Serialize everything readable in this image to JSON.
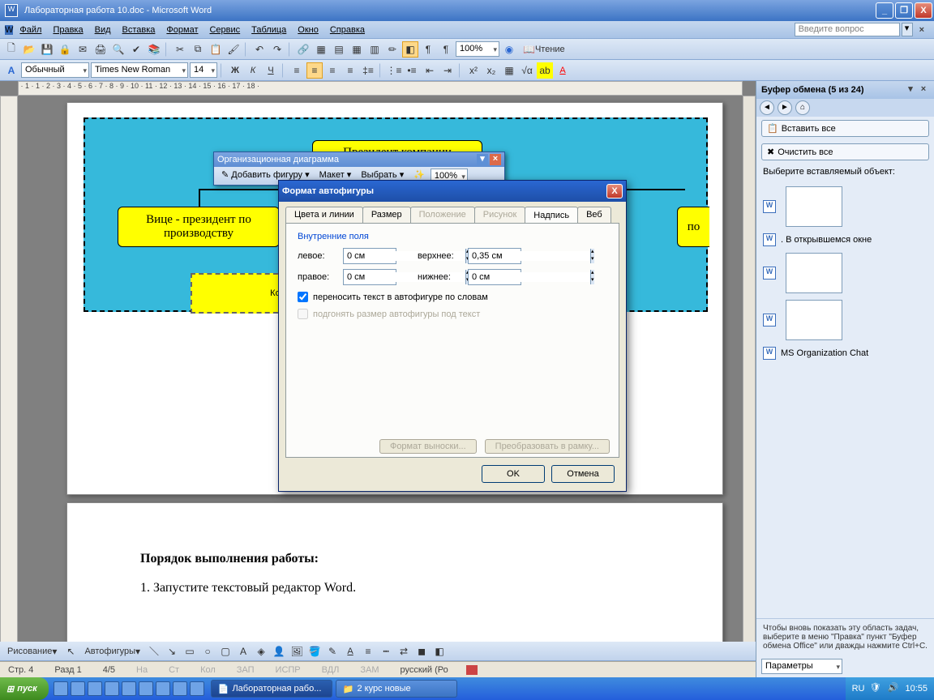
{
  "window": {
    "title": "Лабораторная работа 10.doc - Microsoft Word"
  },
  "menubar": {
    "items": [
      "Файл",
      "Правка",
      "Вид",
      "Вставка",
      "Формат",
      "Сервис",
      "Таблица",
      "Окно",
      "Справка"
    ],
    "ask_placeholder": "Введите вопрос"
  },
  "toolbar1": {
    "zoom": "100%",
    "reading": "Чтение"
  },
  "toolbar2": {
    "style": "Обычный",
    "font": "Times New Roman",
    "size": "14"
  },
  "org_chart_toolbar": {
    "title": "Организационная диаграмма",
    "add_shape": "Добавить фигуру",
    "layout": "Макет",
    "select": "Выбрать",
    "zoom": "100%"
  },
  "org_chart": {
    "president": "Президент компании",
    "vp_left": "Вице - президент по производству",
    "vp_right_fragment": "по",
    "mid_fragment": "Конт"
  },
  "dialog": {
    "title": "Формат автофигуры",
    "tabs": [
      "Цвета и линии",
      "Размер",
      "Положение",
      "Рисунок",
      "Надпись",
      "Веб"
    ],
    "active_tab": 4,
    "group": "Внутренние поля",
    "labels": {
      "left": "левое:",
      "right": "правое:",
      "top": "верхнее:",
      "bottom": "нижнее:"
    },
    "values": {
      "left": "0 см",
      "right": "0 см",
      "top": "0,35 см",
      "bottom": "0 см"
    },
    "chk_wrap": "переносить текст в автофигуре по словам",
    "chk_fit": "подгонять размер автофигуры под текст",
    "btn_callout": "Формат выноски...",
    "btn_convert": "Преобразовать в рамку...",
    "ok": "OK",
    "cancel": "Отмена"
  },
  "task_pane": {
    "title": "Буфер обмена (5 из 24)",
    "paste_all": "Вставить все",
    "clear_all": "Очистить все",
    "choose_label": "Выберите вставляемый объект:",
    "items": [
      {
        "type": "thumb"
      },
      {
        "type": "text",
        "label": ". В открывшемся окне"
      },
      {
        "type": "thumb"
      },
      {
        "type": "thumb"
      },
      {
        "type": "text",
        "label": "MS Organization Chat"
      }
    ],
    "hint": "Чтобы вновь показать эту область задач, выберите в меню \"Правка\" пункт \"Буфер обмена Office\" или дважды нажмите Ctrl+C.",
    "options": "Параметры"
  },
  "document": {
    "heading": "Порядок выполнения работы:",
    "line1": "1. Запустите текстовый редактор Word."
  },
  "statusbar": {
    "page": "Стр. 4",
    "section": "Разд 1",
    "pages": "4/5",
    "at": "На",
    "ln": "Ст",
    "col": "Кол",
    "modes": [
      "ЗАП",
      "ИСПР",
      "ВДЛ",
      "ЗАМ"
    ],
    "lang": "русский (Ро"
  },
  "drawing_bar": {
    "label": "Рисование",
    "autoshapes": "Автофигуры"
  },
  "taskbar": {
    "start": "пуск",
    "tasks": [
      "Лабораторная рабо...",
      "2 курс новые"
    ],
    "lang": "RU",
    "time": "10:55"
  }
}
